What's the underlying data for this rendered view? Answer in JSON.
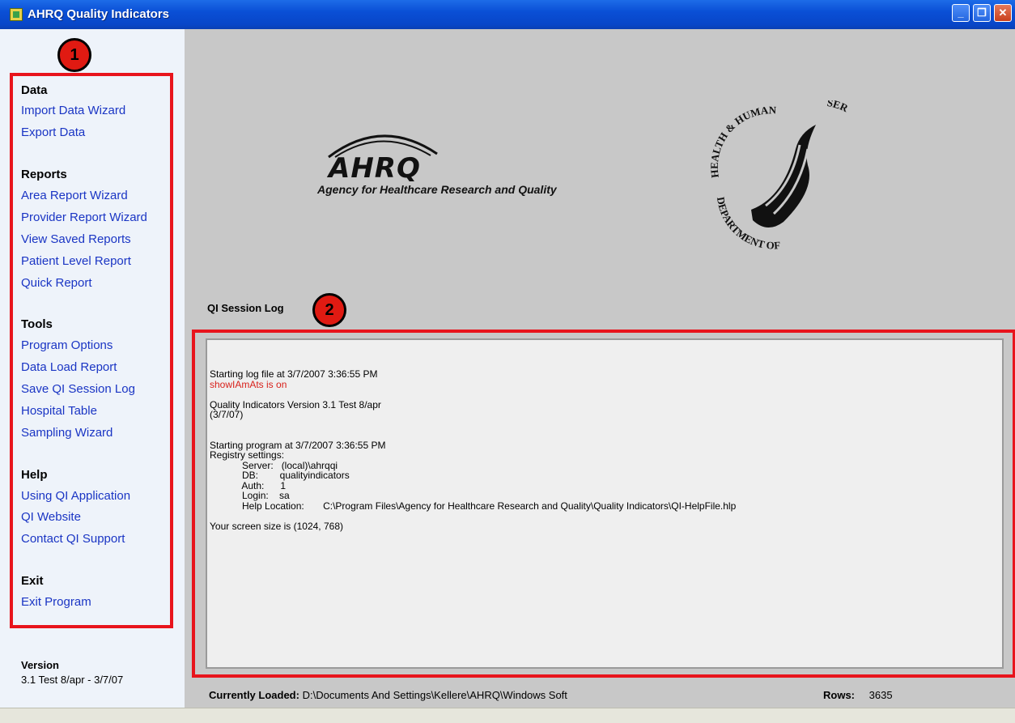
{
  "window": {
    "title": "AHRQ Quality Indicators"
  },
  "markers": {
    "one": "1",
    "two": "2"
  },
  "sidebar": {
    "sections": [
      {
        "title": "Data",
        "items": [
          "Import Data Wizard",
          "Export Data"
        ]
      },
      {
        "title": "Reports",
        "items": [
          "Area Report Wizard",
          "Provider Report Wizard",
          "View Saved Reports",
          "Patient Level Report",
          "Quick Report"
        ]
      },
      {
        "title": "Tools",
        "items": [
          "Program Options",
          "Data Load Report",
          "Save QI Session Log",
          "Hospital Table",
          "Sampling Wizard"
        ]
      },
      {
        "title": "Help",
        "items": [
          "Using QI Application",
          "QI Website",
          "Contact QI Support"
        ]
      },
      {
        "title": "Exit",
        "items": [
          "Exit Program"
        ]
      }
    ],
    "version_label": "Version",
    "version_text": "3.1 Test 8/apr - 3/7/07"
  },
  "logos": {
    "ahrq_word": "AHRQ",
    "ahrq_tagline": "Agency for Healthcare Research and Quality",
    "seal_text_top": "SERVICES·USA",
    "seal_text_left": "HEALTH & HUMAN",
    "seal_text_bottom": "DEPARTMENT OF"
  },
  "log": {
    "label": "QI Session Log",
    "lines": [
      {
        "text": "Starting log file at 3/7/2007 3:36:55 PM"
      },
      {
        "text": "showIAmAts is on",
        "color": "#d8201a"
      },
      {
        "text": ""
      },
      {
        "text": "Quality Indicators Version 3.1 Test 8/apr"
      },
      {
        "text": "(3/7/07)"
      },
      {
        "text": ""
      },
      {
        "text": ""
      },
      {
        "text": "Starting program at 3/7/2007 3:36:55 PM"
      },
      {
        "text": "Registry settings:"
      },
      {
        "text": "            Server:   (local)\\ahrqqi"
      },
      {
        "text": "            DB:        qualityindicators"
      },
      {
        "text": "            Auth:      1"
      },
      {
        "text": "            Login:    sa"
      },
      {
        "text": "            Help Location:       C:\\Program Files\\Agency for Healthcare Research and Quality\\Quality Indicators\\QI-HelpFile.hlp"
      },
      {
        "text": ""
      },
      {
        "text": "Your screen size is (1024, 768)"
      }
    ]
  },
  "status": {
    "loaded_label": "Currently Loaded:",
    "loaded_path": "D:\\Documents And Settings\\Kellere\\AHRQ\\Windows Soft",
    "rows_label": "Rows:",
    "rows_value": "3635"
  }
}
